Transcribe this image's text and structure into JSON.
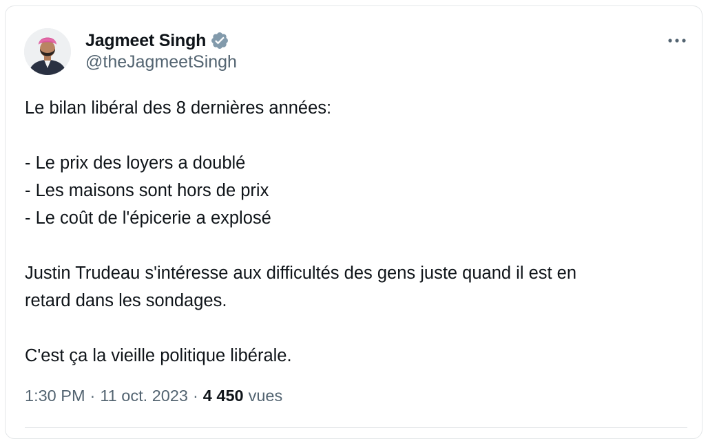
{
  "author": {
    "display_name": "Jagmeet Singh",
    "handle": "@theJagmeetSingh",
    "verified": true,
    "avatar_icon": "profile-photo"
  },
  "tweet": {
    "lines": [
      "Le bilan libéral des 8 dernières années:",
      "",
      "- Le prix des loyers a doublé",
      "- Les maisons sont hors de prix",
      "- Le coût de l'épicerie a explosé",
      "",
      "Justin Trudeau s'intéresse aux difficultés des gens juste quand il est en",
      "retard dans les sondages.",
      "",
      "C'est ça la vieille politique libérale."
    ]
  },
  "meta": {
    "time": "1:30 PM",
    "separator": "·",
    "date": "11 oct. 2023",
    "views_count": "4 450",
    "views_label": "vues"
  },
  "colors": {
    "text_primary": "#0f1419",
    "text_secondary": "#536471",
    "verified_badge": "#829aab",
    "border": "#e3e6e8"
  }
}
